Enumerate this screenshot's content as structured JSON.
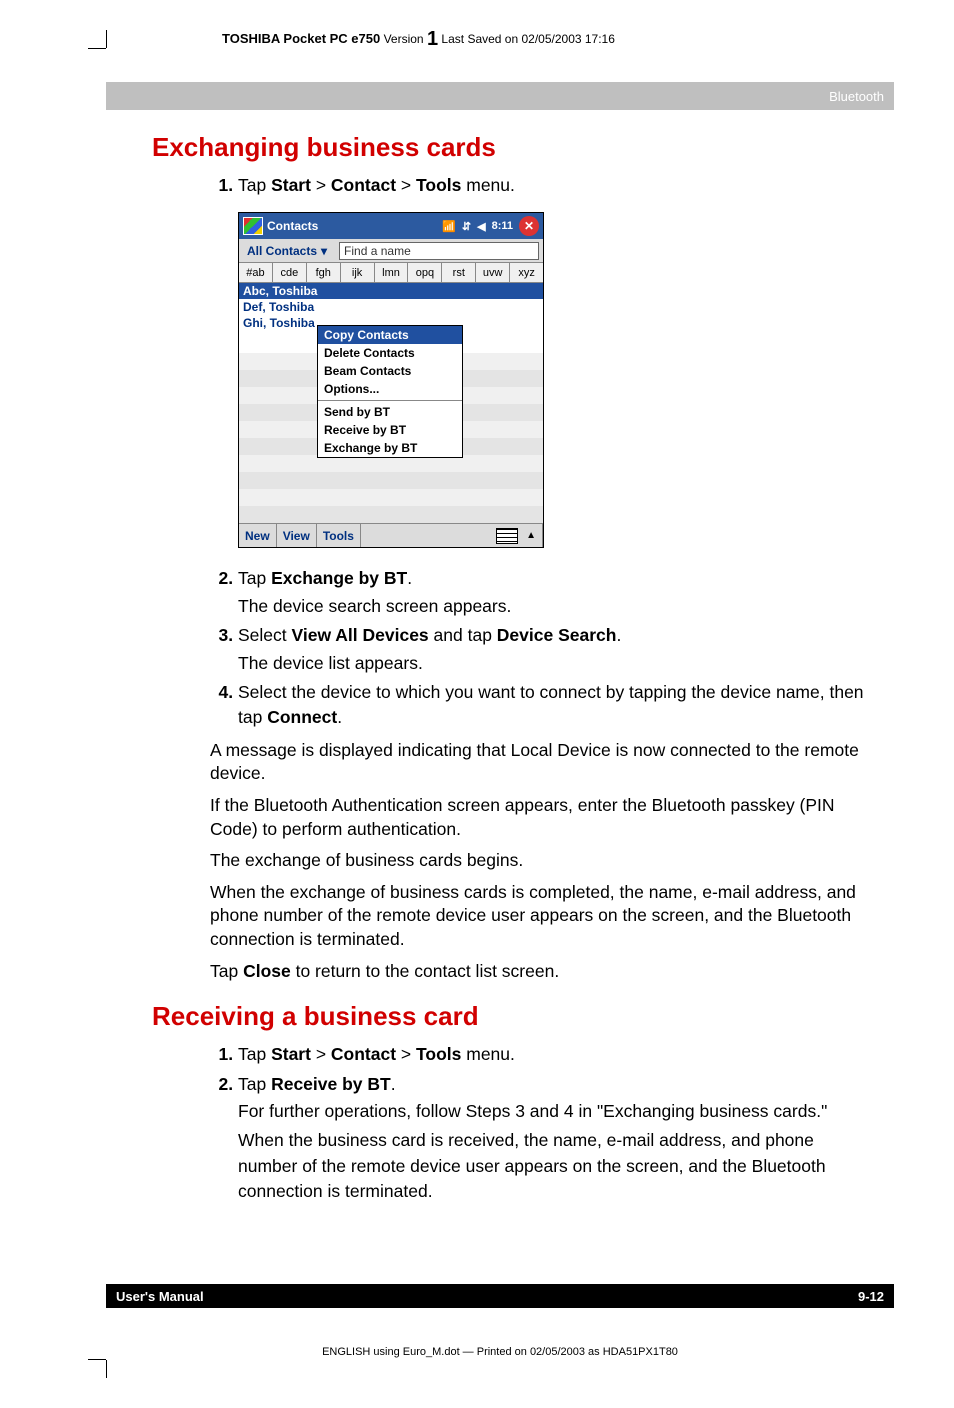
{
  "header": {
    "product": "TOSHIBA Pocket PC e750",
    "version_label": "Version",
    "version_num": "1",
    "saved": "Last Saved on 02/05/2003 17:16"
  },
  "chapter_tab": "Bluetooth",
  "section1": {
    "title": "Exchanging business cards",
    "step1_pre": "Tap ",
    "step1_b1": "Start",
    "step1_gt1": " > ",
    "step1_b2": "Contact",
    "step1_gt2": " > ",
    "step1_b3": "Tools",
    "step1_post": " menu.",
    "step2_pre": "Tap ",
    "step2_b": "Exchange by BT",
    "step2_post": ".",
    "step2_sub": "The device search screen appears.",
    "step3_pre": "Select ",
    "step3_b1": "View All Devices",
    "step3_mid": " and tap ",
    "step3_b2": "Device Search",
    "step3_post": ".",
    "step3_sub": "The device list appears.",
    "step4_pre": "Select the device to which you want to connect by tapping the device name, then tap ",
    "step4_b": "Connect",
    "step4_post": ".",
    "p1": "A message is displayed indicating that Local Device is now connected to the remote device.",
    "p2": "If the Bluetooth Authentication screen appears, enter the Bluetooth passkey (PIN Code) to perform authentication.",
    "p3": "The exchange of business cards begins.",
    "p4": "When the exchange of business cards is completed, the name, e-mail address, and phone number of the remote device user appears on the screen, and the Bluetooth connection is terminated.",
    "p5_pre": "Tap ",
    "p5_b": "Close",
    "p5_post": " to return to the contact list screen."
  },
  "section2": {
    "title": "Receiving a business card",
    "step1_pre": "Tap ",
    "step1_b1": "Start",
    "step1_gt1": " > ",
    "step1_b2": "Contact",
    "step1_gt2": " > ",
    "step1_b3": "Tools",
    "step1_post": " menu.",
    "step2_pre": "Tap ",
    "step2_b": "Receive by BT",
    "step2_post": ".",
    "step2_sub": "For further operations, follow Steps 3 and 4 in \"Exchanging business cards.\"",
    "step2_sub2": "When the business card is received, the name, e-mail address, and phone number of the remote device user appears on the screen, and the Bluetooth connection is terminated."
  },
  "screenshot": {
    "title": "Contacts",
    "time": "8:11",
    "all_contacts": "All Contacts",
    "find": "Find a name",
    "alpha": [
      "#ab",
      "cde",
      "fgh",
      "ijk",
      "lmn",
      "opq",
      "rst",
      "uvw",
      "xyz"
    ],
    "rows": [
      "Abc, Toshiba",
      "Def, Toshiba",
      "Ghi, Toshiba"
    ],
    "menu_header": "Copy Contacts",
    "menu": [
      "Delete Contacts",
      "Beam Contacts",
      "Options...",
      "Send by BT",
      "Receive by BT",
      "Exchange by BT"
    ],
    "bottom": [
      "New",
      "View",
      "Tools"
    ]
  },
  "footer": {
    "left": "User's Manual",
    "right": "9-12"
  },
  "print_line": "ENGLISH using Euro_M.dot — Printed on 02/05/2003 as HDA51PX1T80"
}
